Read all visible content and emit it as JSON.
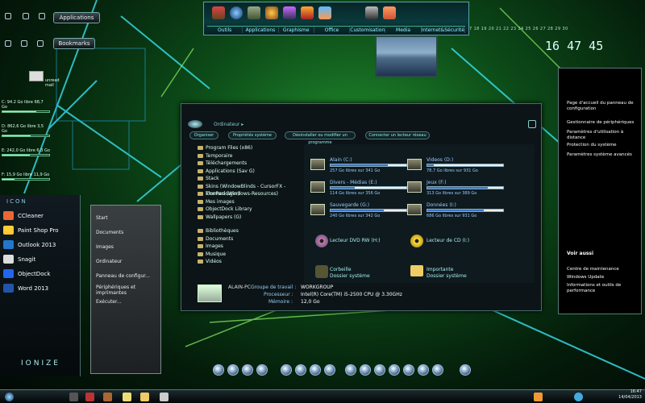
{
  "left_widget": {
    "applications_label": "Applications",
    "bookmarks_label": "Bookmarks",
    "mail_label": "unread mail",
    "drives": [
      {
        "label": "C: 94.2 Go libre 68,7 Go",
        "pct": 0.73
      },
      {
        "label": "D: 862,6 Go libre 3,5 Go",
        "pct": 0.6
      },
      {
        "label": "E: 242,0 Go libre 6,3 Go",
        "pct": 0.58
      },
      {
        "label": "F: 15,9 Go libre 11,9 Go",
        "pct": 0.25
      }
    ]
  },
  "toolbar": {
    "tabs": [
      "Outils",
      "Applications",
      "Graphisme",
      "Office",
      "Customisation",
      "Media",
      "Internet&Sécurité"
    ]
  },
  "dates": "7 18 19 20 21 22 23 24 25 26 27 28 29 30",
  "clock": {
    "time": "16 47 45"
  },
  "explorer": {
    "crumb": "Ordinateur ▸",
    "nav_buttons": [
      "Organiser",
      "Propriétés système",
      "Désinstaller ou modifier un programme",
      "Connecter un lecteur réseau"
    ],
    "tree": [
      "Program Files (x86)",
      "Temporaire",
      "Téléchargements",
      "Applications (Sav G)",
      "Stack",
      "Skins (WindowBlinds - CursorFX - IconPackager)",
      "Themes (Windows-Resources)",
      "Mes images",
      "ObjectDock Library",
      "Wallpapers (G)"
    ],
    "libraries_label": "Bibliothèques",
    "libraries": [
      "Documents",
      "Images",
      "Musique",
      "Vidéos"
    ],
    "drives": [
      {
        "name": "Alain (C:)",
        "free": "257 Go libres sur 341 Go",
        "pct": 0.25
      },
      {
        "name": "Videos (D:)",
        "free": "78,7 Go libres sur 931 Go",
        "pct": 0.92
      },
      {
        "name": "Divers - Médias (E:)",
        "free": "114 Go libres sur 356 Go",
        "pct": 0.68
      },
      {
        "name": "Jeux (F:)",
        "free": "313 Go libres sur 389 Go",
        "pct": 0.2
      },
      {
        "name": "Sauvegarde (G:)",
        "free": "240 Go libres sur 342 Go",
        "pct": 0.3
      },
      {
        "name": "Données (I:)",
        "free": "686 Go libres sur 931 Go",
        "pct": 0.26
      }
    ],
    "dvd": "Lecteur DVD RW (H:)",
    "cd": "Lecteur de CD (I:)",
    "recycle": {
      "name": "Corbeille",
      "sub": "Dossier système"
    },
    "important": {
      "name": "Importante",
      "sub": "Dossier système"
    },
    "pc_name": "ALAIN-PC",
    "details": [
      {
        "k": "Groupe de travail :",
        "v": "WORKGROUP"
      },
      {
        "k": "Processeur :",
        "v": "Intel(R) Core(TM) i5-2500 CPU @ 3.30GHz"
      },
      {
        "k": "Mémoire :",
        "v": "12,0 Go"
      }
    ]
  },
  "right_panel": {
    "home": "Page d'accueil du panneau de configuration",
    "links": [
      "Gestionnaire de périphériques",
      "Paramètres d'utilisation à distance",
      "Protection du système",
      "Paramètres système avancés"
    ],
    "see_also": "Voir aussi",
    "see_links": [
      "Centre de maintenance",
      "Windows Update",
      "Informations et outils de performance"
    ]
  },
  "launcher": {
    "title": "ICON",
    "items": [
      "CCleaner",
      "Paint Shop Pro",
      "Outlook 2013",
      "Snagit",
      "ObjectDock",
      "Word 2013"
    ],
    "brand": "IONIZE"
  },
  "start_menu": {
    "items": [
      "Start",
      "Documents",
      "Images",
      "Ordinateur",
      "Panneau de configur...",
      "Périphériques et imprimantes",
      "Exécuter..."
    ]
  },
  "tray": {
    "time": "16:47",
    "date": "14/04/2013"
  },
  "colors": {
    "accent": "#5fc9d8",
    "bg": "#0c4a18"
  }
}
